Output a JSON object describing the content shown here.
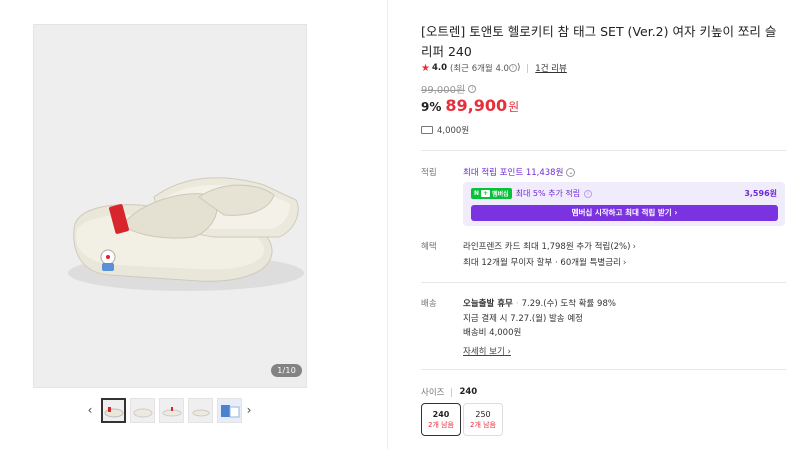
{
  "gallery": {
    "counter": "1/10",
    "thumbnails": [
      "thumb-1",
      "thumb-2",
      "thumb-3",
      "thumb-4",
      "thumb-5"
    ]
  },
  "product": {
    "title": "[오트렌] 토앤토 헬로키티 참 태그 SET (Ver.2) 여자 키높이 쪼리 슬리퍼 240",
    "rating": "4.0",
    "rating_recent": "(최근 6개월 4.0",
    "rating_recent_close": ")",
    "review_link": "1건 리뷰",
    "original_price": "99,000원",
    "discount": "9%",
    "sale_price": "89,900",
    "currency": "원",
    "shipping_fee": "4,000원"
  },
  "points": {
    "label": "적립",
    "max_points": "최대 적립 포인트 11,438원",
    "membership": {
      "badge_n": "N",
      "badge_plus": "+",
      "badge_text": "멤버십",
      "extra_text": "최대 5% 추가 적립",
      "amount": "3,596원",
      "button": "멤버십 시작하고 최대 적립 받기"
    }
  },
  "benefits": {
    "label": "혜택",
    "line1": "라인프렌즈 카드 최대 1,798원 추가 적립(2%)",
    "line2": "최대 12개월 무이자 할부 · 60개월 특별금리"
  },
  "delivery": {
    "label": "배송",
    "today": "오늘출발 휴무",
    "arrival": "7.29.(수) 도착 확률 98%",
    "dispatch": "지금 결제 시 7.27.(월) 발송 예정",
    "fee": "배송비 4,000원",
    "detail_link": "자세히 보기"
  },
  "size": {
    "label": "사이즈",
    "selected": "240",
    "options": [
      {
        "value": "240",
        "stock": "2개 남음"
      },
      {
        "value": "250",
        "stock": "2개 남음"
      }
    ]
  },
  "colors": {
    "accent_red": "#e52f3a",
    "membership_purple": "#7b32e0",
    "npay_green": "#08c13a"
  }
}
